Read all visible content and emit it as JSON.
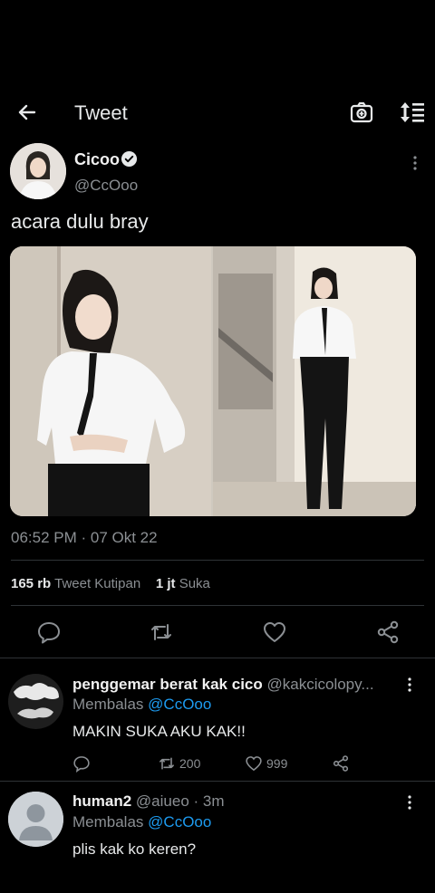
{
  "header": {
    "title": "Tweet"
  },
  "tweet": {
    "author_name": "Cicoo",
    "author_handle": "@CcOoo",
    "text": "acara dulu bray",
    "timestamp": "06:52 PM · 07 Okt 22",
    "quote_count": "165 rb",
    "quote_label": "Tweet Kutipan",
    "like_count": "1 jt",
    "like_label": "Suka"
  },
  "replies": [
    {
      "name": "penggemar berat kak cico",
      "handle": "@kakcicolopy...",
      "replying_prefix": "Membalas",
      "replying_to": "@CcOoo",
      "text": "MAKIN SUKA AKU KAK!!",
      "retweets": "200",
      "likes": "999"
    },
    {
      "name": "human2",
      "handle": "@aiueo · 3m",
      "replying_prefix": "Membalas",
      "replying_to": "@CcOoo",
      "text": "plis kak ko keren?"
    }
  ],
  "colors": {
    "accent": "#1d9bf0",
    "muted": "#8b8f93",
    "background": "#000000",
    "divider": "#2f3336"
  },
  "icons": [
    "back-arrow-icon",
    "camera-icon",
    "sort-icon",
    "verified-badge-icon",
    "more-vertical-icon",
    "reply-icon",
    "retweet-icon",
    "like-icon",
    "share-icon"
  ]
}
